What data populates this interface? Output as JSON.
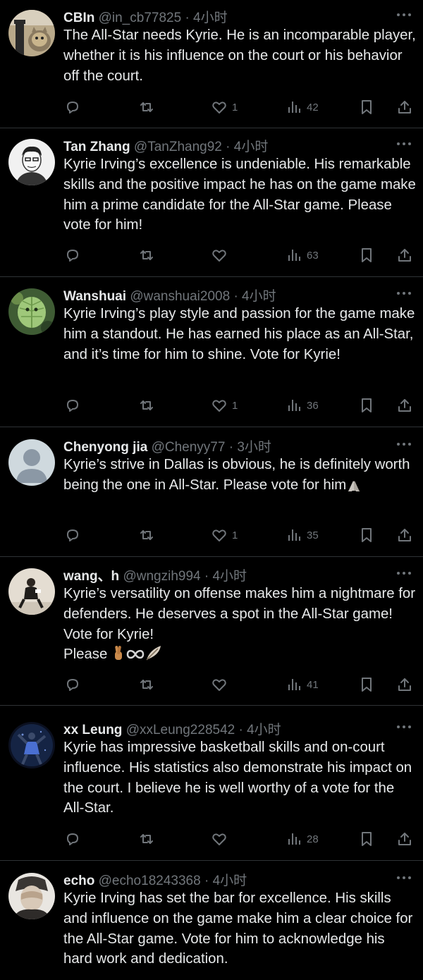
{
  "time_unit": "小时",
  "tweets": [
    {
      "name": "CBIn",
      "handle": "@in_cb77825",
      "dot": "·",
      "time": "4小时",
      "text": "The All-Star needs Kyrie. He is an incomparable player, whether it is his influence on the court or his behavior off the court.",
      "likes": "1",
      "views": "42",
      "avatar_icon": "cat-mascot-avatar"
    },
    {
      "name": "Tan Zhang",
      "handle": "@TanZhang92",
      "dot": "·",
      "time": "4小时",
      "text": "Kyrie Irving’s excellence is undeniable. His remarkable skills and the positive impact he has on the game make him a prime candidate for the All-Star game. Please vote for him!",
      "likes": "",
      "views": "63",
      "avatar_icon": "sketch-portrait-avatar"
    },
    {
      "name": "Wanshuai",
      "handle": "@wanshuai2008",
      "dot": "·",
      "time": "4小时",
      "text": "Kyrie Irving’s play style and passion for the game make him a standout. He has earned his place as an All-Star, and it’s time for him to shine. Vote for Kyrie!",
      "likes": "1",
      "views": "36",
      "avatar_icon": "leaf-mask-avatar"
    },
    {
      "name": "Chenyong jia",
      "handle": "@Chenyy77",
      "dot": "·",
      "time": "3小时",
      "text": "Kyrie’s strive in Dallas is obvious, he is definitely worth being the one in All-Star. Please vote for him",
      "emoji": "🙏",
      "likes": "1",
      "views": "35",
      "avatar_icon": "default-person-avatar"
    },
    {
      "name": "wang、h",
      "handle": "@wngzih994",
      "dot": "·",
      "time": "4小时",
      "text": "Kyrie’s versatility on offense makes him a nightmare for defenders. He deserves a spot in the All-Star game! Vote for Kyrie!",
      "text2": "Please",
      "emoji": "🤞♾🪶",
      "likes": "",
      "views": "41",
      "avatar_icon": "seated-figure-avatar"
    },
    {
      "name": "xx Leung",
      "handle": "@xxLeung228542",
      "dot": "·",
      "time": "4小时",
      "text": "Kyrie has impressive basketball skills and on-court influence. His statistics also demonstrate his impact on the court. I believe he is well worthy of a vote for the All-Star.",
      "likes": "",
      "views": "28",
      "avatar_icon": "basketball-player-avatar"
    },
    {
      "name": "echo",
      "handle": "@echo18243368",
      "dot": "·",
      "time": "4小时",
      "text": "Kyrie Irving has set the bar for excellence. His skills and influence on the game make him a clear choice for the All-Star game. Vote for him to acknowledge his hard work and dedication.",
      "likes": "",
      "views": "",
      "avatar_icon": "hand-over-face-avatar"
    }
  ],
  "icons": {
    "reply": "reply-icon",
    "retweet": "retweet-icon",
    "like": "like-icon",
    "views": "views-icon",
    "bookmark": "bookmark-icon",
    "share": "share-icon",
    "more": "more-icon"
  },
  "colors": {
    "background": "#000000",
    "text": "#e7e9ea",
    "secondary": "#71767b",
    "divider": "#2f3336"
  }
}
